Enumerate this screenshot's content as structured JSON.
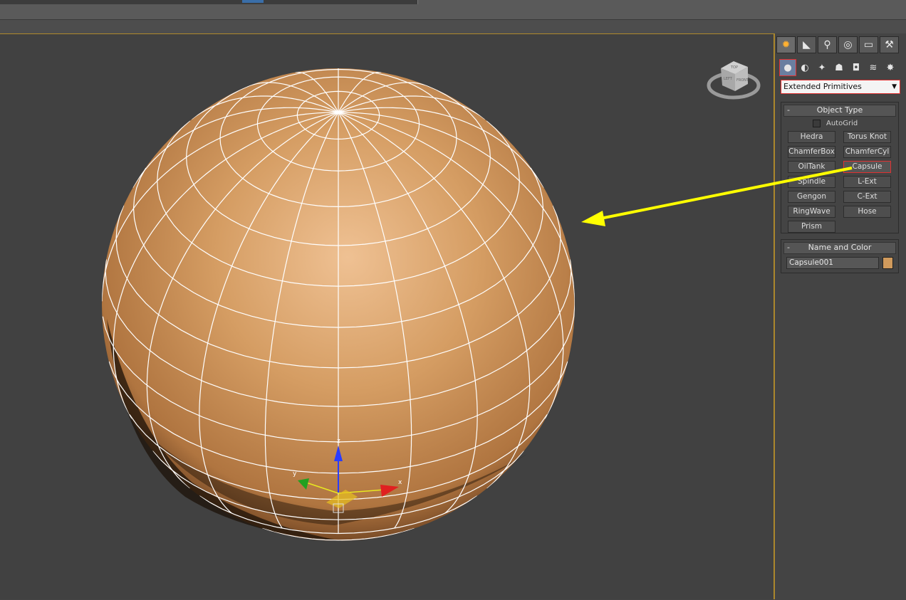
{
  "panel": {
    "tabs": [
      {
        "name": "create-tab-icon",
        "glyph": "✹"
      },
      {
        "name": "modify-tab-icon",
        "glyph": "◣"
      },
      {
        "name": "hierarchy-tab-icon",
        "glyph": "⚲"
      },
      {
        "name": "motion-tab-icon",
        "glyph": "◎"
      },
      {
        "name": "display-tab-icon",
        "glyph": "▭"
      },
      {
        "name": "utilities-tab-icon",
        "glyph": "⚒"
      }
    ],
    "categories": [
      {
        "name": "geometry-category-icon",
        "glyph": "●"
      },
      {
        "name": "shapes-category-icon",
        "glyph": "◐"
      },
      {
        "name": "lights-category-icon",
        "glyph": "✦"
      },
      {
        "name": "cameras-category-icon",
        "glyph": "☗"
      },
      {
        "name": "helpers-category-icon",
        "glyph": "◘"
      },
      {
        "name": "spacewarps-category-icon",
        "glyph": "≋"
      },
      {
        "name": "systems-category-icon",
        "glyph": "✸"
      }
    ],
    "dropdown_value": "Extended Primitives",
    "object_type": {
      "title": "Object Type",
      "collapse": "-",
      "autogrid_label": "AutoGrid",
      "buttons": [
        "Hedra",
        "Torus Knot",
        "ChamferBox",
        "ChamferCyl",
        "OilTank",
        "Capsule",
        "Spindle",
        "L-Ext",
        "Gengon",
        "C-Ext",
        "RingWave",
        "Hose",
        "Prism"
      ],
      "selected": "Capsule"
    },
    "name_and_color": {
      "title": "Name and Color",
      "collapse": "-",
      "object_name": "Capsule001",
      "color": "#d09a5c"
    }
  },
  "viewport": {
    "gizmo_labels": {
      "z": "z",
      "y": "y",
      "x": "x"
    },
    "viewcube_labels": {
      "top": "TOP",
      "front": "FRONT",
      "left": "LEFT"
    }
  },
  "colors": {
    "sphere_base": "#d49a5e",
    "wire": "#ffffff",
    "annotation_arrow": "#ffff00",
    "highlight_box": "#e03030"
  }
}
